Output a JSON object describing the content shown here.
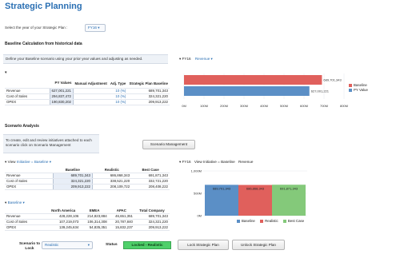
{
  "title": "Strategic Planning",
  "year_prompt": "Select the year of your Strategic Plan :",
  "year_value": "FY16",
  "baseline_section": "Baseline Calculation from historical data",
  "baseline_hint": "Define your Baseline scenario using your prior year values and adjusting as needed.",
  "top_table": {
    "headers": [
      "",
      "PY Values",
      "Manual Adjustment",
      "Adj. Type",
      "Strategic Plan Baseline"
    ],
    "rows": [
      {
        "label": "Revenue",
        "py": "627,001,221",
        "adj": "",
        "type": "10 (%)",
        "base": "689,701,343"
      },
      {
        "label": "Cost of Sales",
        "py": "294,837,472",
        "adj": "",
        "type": "10 (%)",
        "base": "324,321,220"
      },
      {
        "label": "OPEX",
        "py": "190,830,202",
        "adj": "",
        "type": "10 (%)",
        "base": "209,913,222"
      }
    ]
  },
  "top_chart_filter": {
    "year": "FY16",
    "measure": "Revenue"
  },
  "top_chart": {
    "type": "bar",
    "categories": [
      "Revenue"
    ],
    "series": [
      {
        "name": "Baseline",
        "values": [
          689701343
        ],
        "label": "689,701,343",
        "color": "#e0605c"
      },
      {
        "name": "PY Value",
        "values": [
          627001221
        ],
        "label": "627,001,221",
        "color": "#5b8fc6"
      }
    ],
    "ticks": [
      "0M",
      "100M",
      "200M",
      "300M",
      "400M",
      "500M",
      "600M",
      "700M",
      "800M"
    ],
    "xlim": [
      0,
      800000000
    ]
  },
  "scenario_section": "Scenario Analysis",
  "scenario_hint": "To create, edit and review initiatives attached to each scenario click on Scenario Management",
  "scenario_button": "Scenario Management",
  "view_label": "View",
  "view_value": "Initiative = Baseline",
  "mid_table": {
    "headers": [
      "",
      "Baseline",
      "Realistic",
      "Best Case"
    ],
    "rows": [
      {
        "label": "Revenue",
        "b": "689,701,343",
        "r": "686,868,343",
        "c": "691,871,343"
      },
      {
        "label": "Cost of Sales",
        "b": "324,321,220",
        "r": "338,521,220",
        "c": "332,721,220"
      },
      {
        "label": "OPEX",
        "b": "209,913,222",
        "r": "208,109,722",
        "c": "208,408,222"
      }
    ]
  },
  "bot_filter": "Baseline",
  "bot_table": {
    "headers": [
      "",
      "North America",
      "EMEA",
      "APAC",
      "Total Company"
    ],
    "rows": [
      {
        "label": "Revenue",
        "na": "428,228,106",
        "em": "214,823,884",
        "ap": "46,651,351",
        "tc": "689,701,343"
      },
      {
        "label": "Cost of Sales",
        "na": "107,219,073",
        "em": "106,314,308",
        "ap": "20,787,840",
        "tc": "324,321,220"
      },
      {
        "label": "OPEX",
        "na": "139,245,634",
        "em": "54,835,351",
        "ap": "15,832,237",
        "tc": "209,913,222"
      }
    ]
  },
  "right_chart_filter": {
    "year": "FY16",
    "view": "View Initiative = Baseline",
    "measure": "Revenue"
  },
  "right_chart": {
    "type": "bar",
    "categories": [
      "Revenue"
    ],
    "series": [
      {
        "name": "Baseline",
        "values": [
          689701343
        ],
        "label": "689,701,343",
        "color": "#5b8fc6"
      },
      {
        "name": "Realistic",
        "values": [
          686868343
        ],
        "label": "686,868,343",
        "color": "#e0605c"
      },
      {
        "name": "Best Case",
        "values": [
          691871343
        ],
        "label": "691,871,343",
        "color": "#84c97a"
      }
    ],
    "ticks": [
      "1,000M",
      "500M",
      "0M"
    ],
    "ylim": [
      0,
      1000000000
    ]
  },
  "footer": {
    "scenario_label": "Scenario to Lock",
    "scenario_value": "Realistic",
    "status_label": "Status",
    "status_value": "Locked - Realistic",
    "lock_btn": "Lock Strategic Plan",
    "unlock_btn": "Unlock Strategic Plan"
  }
}
